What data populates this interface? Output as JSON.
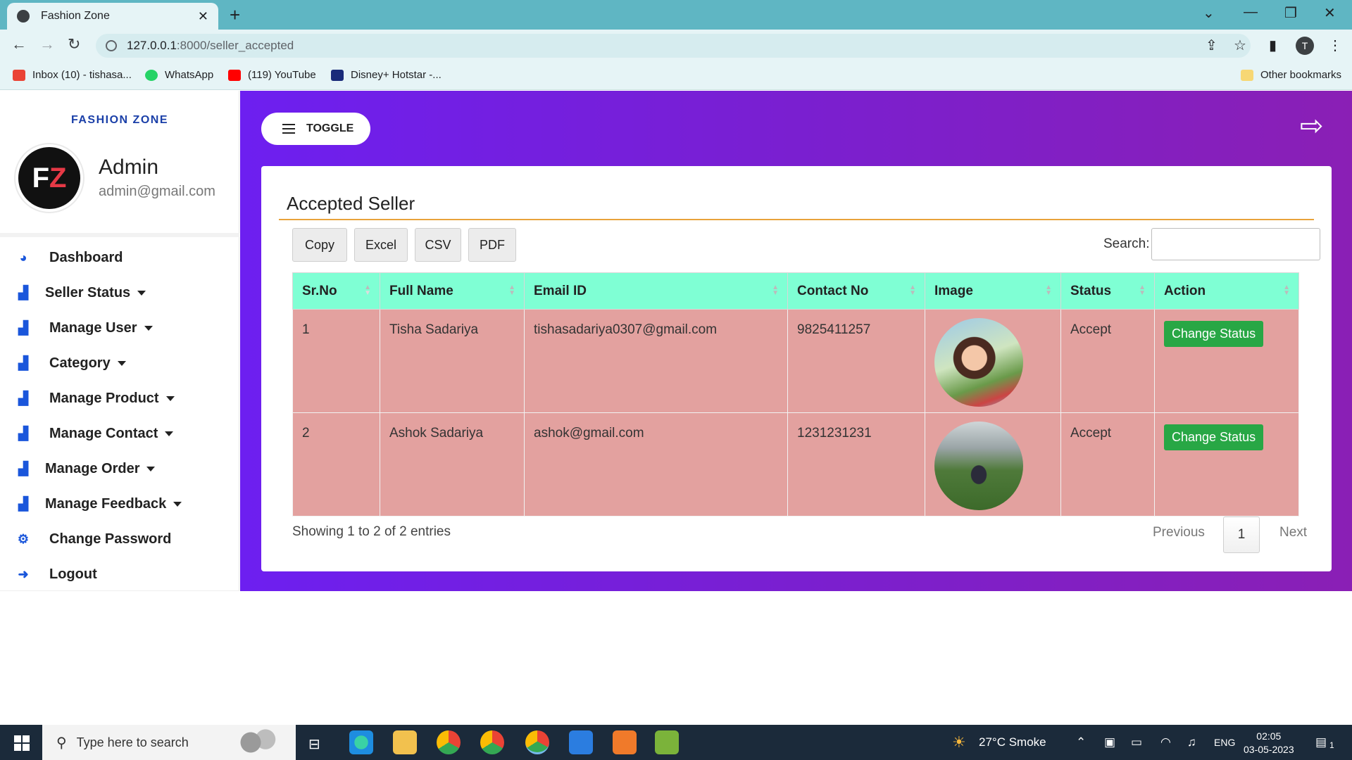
{
  "browser": {
    "tab_title": "Fashion Zone",
    "url_host": "127.0.0.1",
    "url_path": ":8000/seller_accepted",
    "bookmarks": [
      {
        "label": "Inbox (10) - tishasa...",
        "color": "#ea4335"
      },
      {
        "label": "WhatsApp",
        "color": "#25d366"
      },
      {
        "label": "(119) YouTube",
        "color": "#ff0000"
      },
      {
        "label": "Disney+ Hotstar -...",
        "color": "#1a2b7a"
      }
    ],
    "other_bookmarks": "Other bookmarks",
    "profile_initial": "T"
  },
  "sidebar": {
    "brand": "FASHION ZONE",
    "admin_name": "Admin",
    "admin_email": "admin@gmail.com",
    "items": [
      {
        "label": "Dashboard",
        "icon": "dashboard-icon",
        "caret": false
      },
      {
        "label": "Seller Status",
        "icon": "chart-icon",
        "caret": true
      },
      {
        "label": "Manage User",
        "icon": "chart-icon",
        "caret": true
      },
      {
        "label": "Category",
        "icon": "chart-icon",
        "caret": true
      },
      {
        "label": "Manage Product",
        "icon": "chart-icon",
        "caret": true
      },
      {
        "label": "Manage Contact",
        "icon": "chart-icon",
        "caret": true
      },
      {
        "label": "Manage Order",
        "icon": "chart-icon",
        "caret": true
      },
      {
        "label": "Manage Feedback",
        "icon": "chart-icon",
        "caret": true
      },
      {
        "label": "Change Password",
        "icon": "gear-icon",
        "caret": false
      },
      {
        "label": "Logout",
        "icon": "logout-icon",
        "caret": false
      }
    ]
  },
  "main": {
    "toggle_label": "TOGGLE",
    "card_title": "Accepted Seller",
    "export_buttons": [
      "Copy",
      "Excel",
      "CSV",
      "PDF"
    ],
    "search_label": "Search:",
    "columns": [
      "Sr.No",
      "Full Name",
      "Email ID",
      "Contact No",
      "Image",
      "Status",
      "Action"
    ],
    "rows": [
      {
        "srno": "1",
        "name": "Tisha Sadariya",
        "email": "tishasadariya0307@gmail.com",
        "contact": "9825411257",
        "status": "Accept",
        "action": "Change Status"
      },
      {
        "srno": "2",
        "name": "Ashok Sadariya",
        "email": "ashok@gmail.com",
        "contact": "1231231231",
        "status": "Accept",
        "action": "Change Status"
      }
    ],
    "showing": "Showing 1 to 2 of 2 entries",
    "pagination": {
      "previous": "Previous",
      "current": "1",
      "next": "Next"
    }
  },
  "taskbar": {
    "search_placeholder": "Type here to search",
    "weather": "27°C  Smoke",
    "lang": "ENG",
    "time": "02:05",
    "date": "03-05-2023",
    "notif_count": "1"
  },
  "colors": {
    "header_row": "#7fffd4",
    "body_row": "#e3a19f",
    "action_button": "#28a745",
    "gradient_start": "#6d1ff0",
    "gradient_end": "#8a1fb5"
  }
}
